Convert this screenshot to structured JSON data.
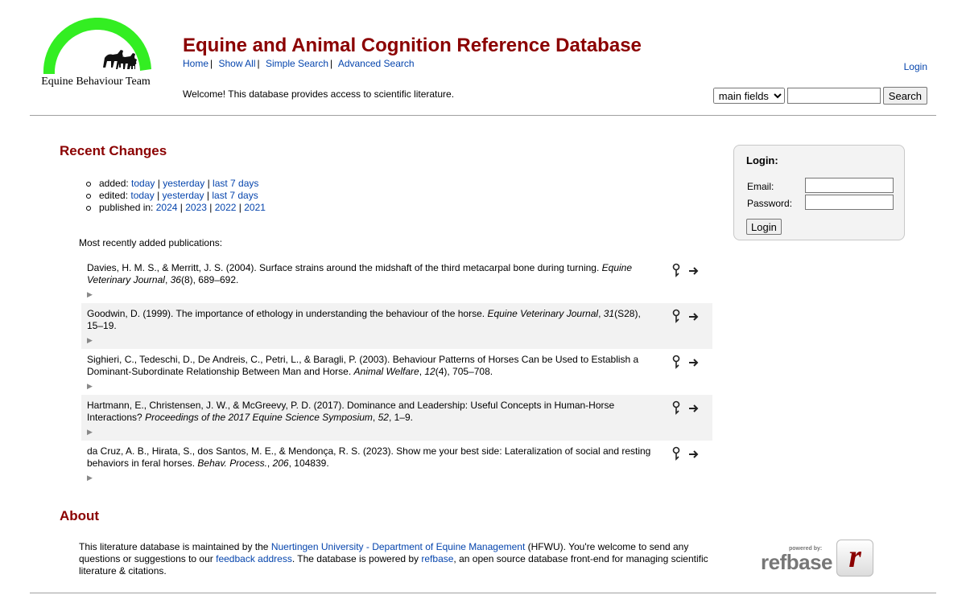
{
  "header": {
    "logo_text": "Equine Behaviour Team",
    "title": "Equine and Animal Cognition Reference Database",
    "nav": [
      "Home",
      "Show All",
      "Simple Search",
      "Advanced Search"
    ],
    "welcome": "Welcome! This database provides access to scientific literature.",
    "login_link": "Login",
    "search": {
      "field_select": "main fields",
      "query": "",
      "button": "Search"
    }
  },
  "recent_changes": {
    "heading": "Recent Changes",
    "added_label": "added:",
    "edited_label": "edited:",
    "published_label": "published in:",
    "links": {
      "today": "today",
      "yesterday": "yesterday",
      "last7": "last 7 days"
    },
    "years": [
      "2024",
      "2023",
      "2022",
      "2021"
    ],
    "recent_label": "Most recently added publications:"
  },
  "publications": [
    {
      "text": "Davies, H. M. S., & Merritt, J. S. (2004). Surface strains around the midshaft of the third metacarpal bone during turning.",
      "journal": "Equine Veterinary Journal",
      "vol_sep": ", ",
      "volume": "36",
      "rest": "(8), 689–692."
    },
    {
      "text": "Goodwin, D. (1999). The importance of ethology in understanding the behaviour of the horse.",
      "journal": "Equine Veterinary Journal",
      "vol_sep": ", ",
      "volume": "31",
      "rest": "(S28), 15–19."
    },
    {
      "text": "Sighieri, C., Tedeschi, D., De Andreis, C., Petri, L., & Baragli, P. (2003). Behaviour Patterns of Horses Can be Used to Establish a Dominant-Subordinate Relationship Between Man and Horse.",
      "journal": "Animal Welfare",
      "vol_sep": ", ",
      "volume": "12",
      "rest": "(4), 705–708."
    },
    {
      "text": "Hartmann, E., Christensen, J. W., & McGreevy, P. D. (2017). Dominance and Leadership: Useful Concepts in Human-Horse Interactions?",
      "journal": "Proceedings of the 2017 Equine Science Symposium",
      "vol_sep": ", ",
      "volume": "52",
      "rest": ", 1–9."
    },
    {
      "text": "da Cruz, A. B., Hirata, S., dos Santos, M. E., & Mendonça, R. S. (2023). Show me your best side: Lateralization of social and resting behaviors in feral horses.",
      "journal": "Behav. Process.",
      "vol_sep": ", ",
      "volume": "206",
      "rest": ", 104839."
    }
  ],
  "login_box": {
    "title": "Login:",
    "email_label": "Email:",
    "password_label": "Password:",
    "button": "Login"
  },
  "about": {
    "heading": "About",
    "part1": "This literature database is maintained by the ",
    "org_link": "Nuertingen University - Department of Equine Management",
    "part2": " (HFWU). You're welcome to send any questions or suggestions to our ",
    "feedback_link": "feedback address",
    "part3": ". The database is powered by ",
    "refbase_link": "refbase",
    "part4": ", an open source database front-end for managing scientific literature & citations.",
    "powered_by": "powered by:",
    "refbase_word": "refbase",
    "refbase_letter": "r"
  },
  "colors": {
    "title": "#8b0000",
    "link": "#0645ad",
    "arc": "#33ee22"
  },
  "icons": [
    "horses-silhouette-icon",
    "magnifier-detail-icon",
    "arrow-right-icon",
    "disclosure-triangle-icon"
  ]
}
